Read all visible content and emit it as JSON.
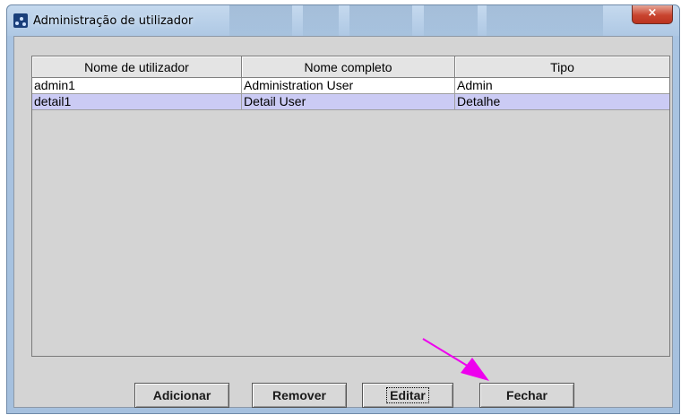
{
  "window": {
    "title": "Administração de utilizador",
    "close_icon": "×"
  },
  "table": {
    "columns": [
      "Nome de utilizador",
      "Nome completo",
      "Tipo"
    ],
    "rows": [
      {
        "username": "admin1",
        "fullname": "Administration User",
        "type": "Admin",
        "selected": false
      },
      {
        "username": "detail1",
        "fullname": "Detail User",
        "type": "Detalhe",
        "selected": true
      }
    ]
  },
  "buttons": {
    "add": "Adicionar",
    "remove": "Remover",
    "edit": "Editar",
    "close": "Fechar"
  },
  "colors": {
    "selection": "#cbcbf4",
    "annotation_arrow": "#ee00ee"
  },
  "icons": {
    "app": "app-icon",
    "close": "close-icon",
    "annotation": "arrow-annotation-icon"
  }
}
